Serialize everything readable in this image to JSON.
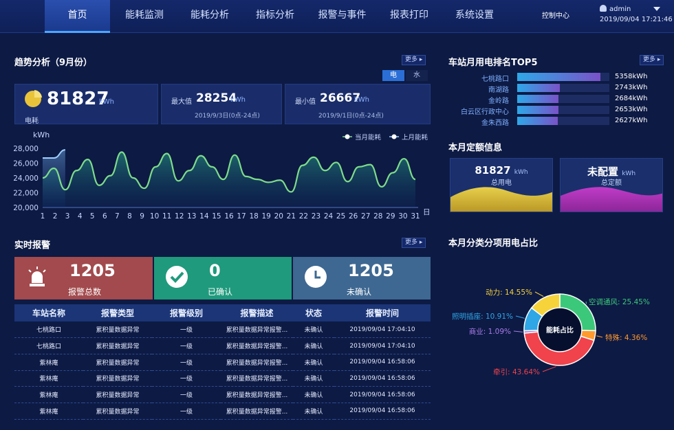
{
  "nav": {
    "items": [
      "首页",
      "能耗监测",
      "能耗分析",
      "指标分析",
      "报警与事件",
      "报表打印",
      "系统设置"
    ],
    "control_center": "控制中心",
    "user": "admin",
    "datetime": "2019/09/04 17:21:46"
  },
  "trend": {
    "title": "趋势分析（9月份）",
    "more": "更多 ▸",
    "tab_elec": "电",
    "tab_water": "水",
    "total_value": "81827",
    "total_unit": "kWh",
    "total_label": "电耗",
    "max_label": "最大值",
    "max_value": "28254",
    "max_unit": "kWh",
    "max_time": "2019/9/3日(0点-24点)",
    "min_label": "最小值",
    "min_value": "26667",
    "min_unit": "kWh",
    "min_time": "2019/9/1日(0点-24点)"
  },
  "chart_data": {
    "type": "line",
    "ylabel": "kWh",
    "xlabel": "日",
    "ylim": [
      20000,
      28000
    ],
    "yticks": [
      "28,000",
      "26,000",
      "24,000",
      "22,000",
      "20,000"
    ],
    "x": [
      1,
      2,
      3,
      4,
      5,
      6,
      7,
      8,
      9,
      10,
      11,
      12,
      13,
      14,
      15,
      16,
      17,
      18,
      19,
      20,
      21,
      22,
      23,
      24,
      25,
      26,
      27,
      28,
      29,
      30,
      31
    ],
    "series": [
      {
        "name": "当月能耗",
        "values": [
          24000,
          25300,
          22400,
          25000,
          26500,
          23000,
          24300,
          27500,
          24000,
          22600,
          25500,
          27300,
          23600,
          25000,
          27000,
          25500,
          23800,
          27100,
          24200,
          23800,
          23400,
          23700,
          22100,
          25700,
          26800,
          25000,
          26100,
          23500,
          25500,
          25800,
          22800,
          24700,
          26600,
          23800
        ]
      },
      {
        "name": "上月能耗",
        "values": [
          26700,
          26700,
          27800
        ]
      }
    ],
    "legend": [
      "当月能耗",
      "上月能耗"
    ]
  },
  "alarm": {
    "title": "实时报警",
    "more": "更多 ▸",
    "total_num": "1205",
    "total_label": "报警总数",
    "confirmed_num": "0",
    "confirmed_label": "已确认",
    "unconfirmed_num": "1205",
    "unconfirmed_label": "未确认",
    "headers": [
      "车站名称",
      "报警类型",
      "报警级别",
      "报警描述",
      "状态",
      "报警时间"
    ],
    "rows": [
      [
        "七桃路口",
        "累积量数据异常",
        "一级",
        "累积量数据异常报警...",
        "未确认",
        "2019/09/04 17:04:10"
      ],
      [
        "七桃路口",
        "累积量数据异常",
        "一级",
        "累积量数据异常报警...",
        "未确认",
        "2019/09/04 17:04:10"
      ],
      [
        "紫林庵",
        "累积量数据异常",
        "一级",
        "累积量数据异常报警...",
        "未确认",
        "2019/09/04 16:58:06"
      ],
      [
        "紫林庵",
        "累积量数据异常",
        "一级",
        "累积量数据异常报警...",
        "未确认",
        "2019/09/04 16:58:06"
      ],
      [
        "紫林庵",
        "累积量数据异常",
        "一级",
        "累积量数据异常报警...",
        "未确认",
        "2019/09/04 16:58:06"
      ],
      [
        "紫林庵",
        "累积量数据异常",
        "一级",
        "累积量数据异常报警...",
        "未确认",
        "2019/09/04 16:58:06"
      ]
    ]
  },
  "rank": {
    "title": "车站月用电排名TOP5",
    "more": "更多 ▸",
    "items": [
      {
        "name": "七桃路口",
        "value": "5358kWh",
        "fraction": 0.9
      },
      {
        "name": "南湖路",
        "value": "2743kWh",
        "fraction": 0.46
      },
      {
        "name": "金岭路",
        "value": "2684kWh",
        "fraction": 0.45
      },
      {
        "name": "白云区行政中心",
        "value": "2653kWh",
        "fraction": 0.45
      },
      {
        "name": "金朱西路",
        "value": "2627kWh",
        "fraction": 0.44
      }
    ]
  },
  "quota": {
    "title": "本月定额信息",
    "total_value": "81827",
    "total_unit": "kWh",
    "total_label": "总用电",
    "quota_value": "未配置",
    "quota_unit": "kWh",
    "quota_label": "总定额"
  },
  "donut": {
    "title": "本月分类分项用电占比",
    "center": "能耗占比",
    "slices": [
      {
        "name": "空调通风",
        "pct": 25.45,
        "label": "空调通风: 25.45%",
        "color": "#3cc87a"
      },
      {
        "name": "特殊",
        "pct": 4.36,
        "label": "特殊: 4.36%",
        "color": "#ff9a2e"
      },
      {
        "name": "牵引",
        "pct": 43.64,
        "label": "牵引: 43.64%",
        "color": "#f0434c"
      },
      {
        "name": "商业",
        "pct": 1.09,
        "label": "商业: 1.09%",
        "color": "#a97be8"
      },
      {
        "name": "照明插座",
        "pct": 10.91,
        "label": "照明插座: 10.91%",
        "color": "#2fa6e6"
      },
      {
        "name": "动力",
        "pct": 14.55,
        "label": "动力: 14.55%",
        "color": "#f6d33a"
      }
    ]
  }
}
